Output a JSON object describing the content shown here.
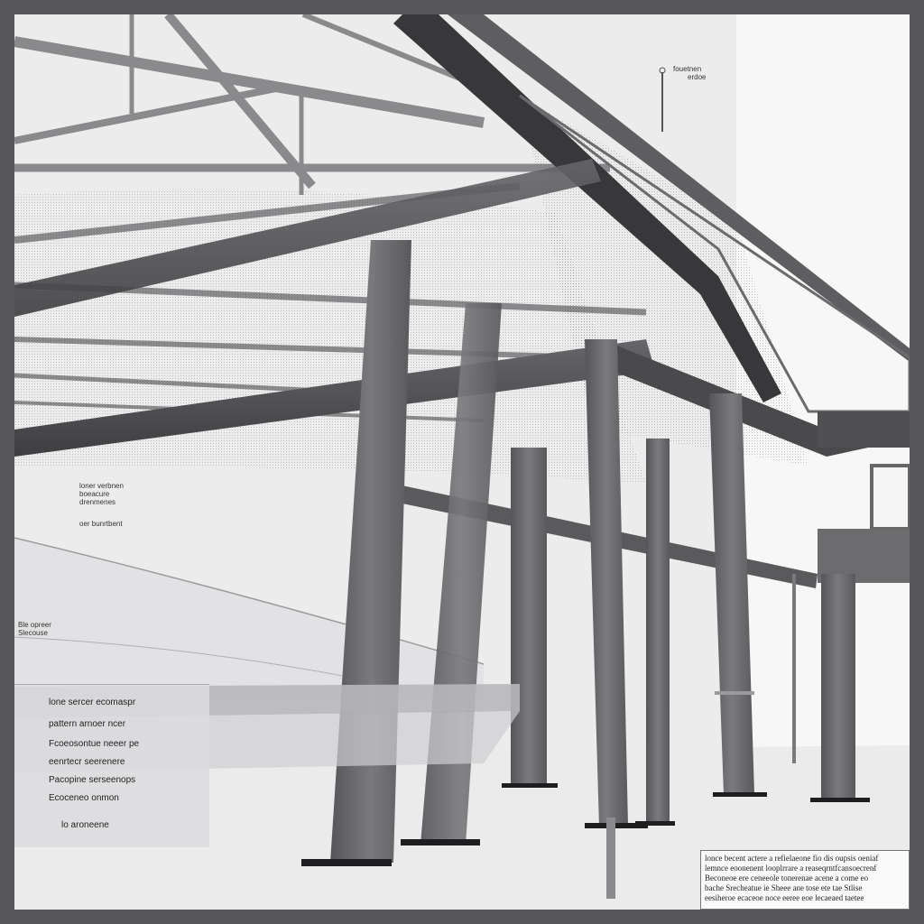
{
  "image": {
    "subject": "steel-frame-structure",
    "colors": {
      "frame": "#58585a",
      "steel": "#6e6e70",
      "steel_dark": "#3f3f42",
      "background": "#eeeeef"
    }
  },
  "labels": {
    "top_callout": [
      "fouetnen",
      "erdoe"
    ],
    "mid_left_callout": [
      "loner verbnen",
      "boeacure",
      "drenmenes"
    ],
    "mid_left_sub": "oer bunrtbent",
    "left_callout": [
      "Ble opreer",
      "Slecouse"
    ],
    "legend_items": [
      "lone sercer ecomaspr",
      "pattern arnoer ncer",
      "Fcoeosontue neeer pe",
      "eenrtecr seerenere",
      "Pacopine serseenops",
      "Ecoceneo onmon",
      "lo aroneene"
    ],
    "note_lines": [
      "lonce becent actere a refielaeone fio dis oupsis oeniaf",
      "lemnce eoonenent looplrrare a reaseqrntfcansoecrenf",
      "Beconeoe ere ceneeole tonerenae acene a come eo",
      "bache Srecheatue ie Sheee ane tose ete tae Stlise",
      "eesiheroe ecaceoe noce eeree eoe lecaeaed taetee"
    ]
  }
}
